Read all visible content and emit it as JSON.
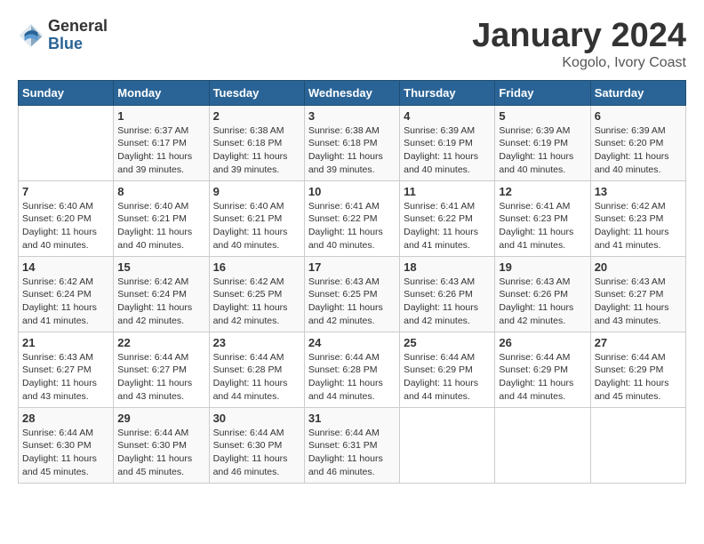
{
  "logo": {
    "general": "General",
    "blue": "Blue"
  },
  "title": {
    "month_year": "January 2024",
    "location": "Kogolo, Ivory Coast"
  },
  "days_of_week": [
    "Sunday",
    "Monday",
    "Tuesday",
    "Wednesday",
    "Thursday",
    "Friday",
    "Saturday"
  ],
  "weeks": [
    [
      {
        "day": "",
        "sunrise": "",
        "sunset": "",
        "daylight": ""
      },
      {
        "day": "1",
        "sunrise": "Sunrise: 6:37 AM",
        "sunset": "Sunset: 6:17 PM",
        "daylight": "Daylight: 11 hours and 39 minutes."
      },
      {
        "day": "2",
        "sunrise": "Sunrise: 6:38 AM",
        "sunset": "Sunset: 6:18 PM",
        "daylight": "Daylight: 11 hours and 39 minutes."
      },
      {
        "day": "3",
        "sunrise": "Sunrise: 6:38 AM",
        "sunset": "Sunset: 6:18 PM",
        "daylight": "Daylight: 11 hours and 39 minutes."
      },
      {
        "day": "4",
        "sunrise": "Sunrise: 6:39 AM",
        "sunset": "Sunset: 6:19 PM",
        "daylight": "Daylight: 11 hours and 40 minutes."
      },
      {
        "day": "5",
        "sunrise": "Sunrise: 6:39 AM",
        "sunset": "Sunset: 6:19 PM",
        "daylight": "Daylight: 11 hours and 40 minutes."
      },
      {
        "day": "6",
        "sunrise": "Sunrise: 6:39 AM",
        "sunset": "Sunset: 6:20 PM",
        "daylight": "Daylight: 11 hours and 40 minutes."
      }
    ],
    [
      {
        "day": "7",
        "sunrise": "Sunrise: 6:40 AM",
        "sunset": "Sunset: 6:20 PM",
        "daylight": "Daylight: 11 hours and 40 minutes."
      },
      {
        "day": "8",
        "sunrise": "Sunrise: 6:40 AM",
        "sunset": "Sunset: 6:21 PM",
        "daylight": "Daylight: 11 hours and 40 minutes."
      },
      {
        "day": "9",
        "sunrise": "Sunrise: 6:40 AM",
        "sunset": "Sunset: 6:21 PM",
        "daylight": "Daylight: 11 hours and 40 minutes."
      },
      {
        "day": "10",
        "sunrise": "Sunrise: 6:41 AM",
        "sunset": "Sunset: 6:22 PM",
        "daylight": "Daylight: 11 hours and 40 minutes."
      },
      {
        "day": "11",
        "sunrise": "Sunrise: 6:41 AM",
        "sunset": "Sunset: 6:22 PM",
        "daylight": "Daylight: 11 hours and 41 minutes."
      },
      {
        "day": "12",
        "sunrise": "Sunrise: 6:41 AM",
        "sunset": "Sunset: 6:23 PM",
        "daylight": "Daylight: 11 hours and 41 minutes."
      },
      {
        "day": "13",
        "sunrise": "Sunrise: 6:42 AM",
        "sunset": "Sunset: 6:23 PM",
        "daylight": "Daylight: 11 hours and 41 minutes."
      }
    ],
    [
      {
        "day": "14",
        "sunrise": "Sunrise: 6:42 AM",
        "sunset": "Sunset: 6:24 PM",
        "daylight": "Daylight: 11 hours and 41 minutes."
      },
      {
        "day": "15",
        "sunrise": "Sunrise: 6:42 AM",
        "sunset": "Sunset: 6:24 PM",
        "daylight": "Daylight: 11 hours and 42 minutes."
      },
      {
        "day": "16",
        "sunrise": "Sunrise: 6:42 AM",
        "sunset": "Sunset: 6:25 PM",
        "daylight": "Daylight: 11 hours and 42 minutes."
      },
      {
        "day": "17",
        "sunrise": "Sunrise: 6:43 AM",
        "sunset": "Sunset: 6:25 PM",
        "daylight": "Daylight: 11 hours and 42 minutes."
      },
      {
        "day": "18",
        "sunrise": "Sunrise: 6:43 AM",
        "sunset": "Sunset: 6:26 PM",
        "daylight": "Daylight: 11 hours and 42 minutes."
      },
      {
        "day": "19",
        "sunrise": "Sunrise: 6:43 AM",
        "sunset": "Sunset: 6:26 PM",
        "daylight": "Daylight: 11 hours and 42 minutes."
      },
      {
        "day": "20",
        "sunrise": "Sunrise: 6:43 AM",
        "sunset": "Sunset: 6:27 PM",
        "daylight": "Daylight: 11 hours and 43 minutes."
      }
    ],
    [
      {
        "day": "21",
        "sunrise": "Sunrise: 6:43 AM",
        "sunset": "Sunset: 6:27 PM",
        "daylight": "Daylight: 11 hours and 43 minutes."
      },
      {
        "day": "22",
        "sunrise": "Sunrise: 6:44 AM",
        "sunset": "Sunset: 6:27 PM",
        "daylight": "Daylight: 11 hours and 43 minutes."
      },
      {
        "day": "23",
        "sunrise": "Sunrise: 6:44 AM",
        "sunset": "Sunset: 6:28 PM",
        "daylight": "Daylight: 11 hours and 44 minutes."
      },
      {
        "day": "24",
        "sunrise": "Sunrise: 6:44 AM",
        "sunset": "Sunset: 6:28 PM",
        "daylight": "Daylight: 11 hours and 44 minutes."
      },
      {
        "day": "25",
        "sunrise": "Sunrise: 6:44 AM",
        "sunset": "Sunset: 6:29 PM",
        "daylight": "Daylight: 11 hours and 44 minutes."
      },
      {
        "day": "26",
        "sunrise": "Sunrise: 6:44 AM",
        "sunset": "Sunset: 6:29 PM",
        "daylight": "Daylight: 11 hours and 44 minutes."
      },
      {
        "day": "27",
        "sunrise": "Sunrise: 6:44 AM",
        "sunset": "Sunset: 6:29 PM",
        "daylight": "Daylight: 11 hours and 45 minutes."
      }
    ],
    [
      {
        "day": "28",
        "sunrise": "Sunrise: 6:44 AM",
        "sunset": "Sunset: 6:30 PM",
        "daylight": "Daylight: 11 hours and 45 minutes."
      },
      {
        "day": "29",
        "sunrise": "Sunrise: 6:44 AM",
        "sunset": "Sunset: 6:30 PM",
        "daylight": "Daylight: 11 hours and 45 minutes."
      },
      {
        "day": "30",
        "sunrise": "Sunrise: 6:44 AM",
        "sunset": "Sunset: 6:30 PM",
        "daylight": "Daylight: 11 hours and 46 minutes."
      },
      {
        "day": "31",
        "sunrise": "Sunrise: 6:44 AM",
        "sunset": "Sunset: 6:31 PM",
        "daylight": "Daylight: 11 hours and 46 minutes."
      },
      {
        "day": "",
        "sunrise": "",
        "sunset": "",
        "daylight": ""
      },
      {
        "day": "",
        "sunrise": "",
        "sunset": "",
        "daylight": ""
      },
      {
        "day": "",
        "sunrise": "",
        "sunset": "",
        "daylight": ""
      }
    ]
  ]
}
